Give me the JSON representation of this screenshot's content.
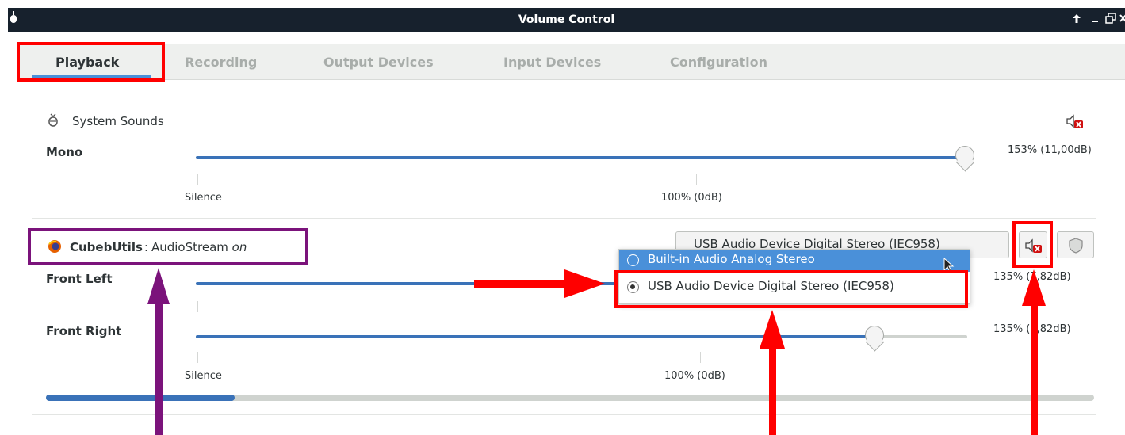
{
  "window": {
    "title": "Volume Control"
  },
  "tabs": [
    "Playback",
    "Recording",
    "Output Devices",
    "Input Devices",
    "Configuration"
  ],
  "system_sounds": {
    "name": "System Sounds",
    "channel": "Mono",
    "level_label": "153% (11,00dB)",
    "level_percent": 153,
    "scale_low": "Silence",
    "scale_mid": "100% (0dB)"
  },
  "stream": {
    "app": "CubebUtils",
    "separator": ":",
    "name": "AudioStream",
    "state": "on",
    "device": "USB Audio Device Digital Stereo (IEC958)",
    "channels": [
      {
        "name": "Front Left",
        "level_label": "135% (7,82dB)",
        "level_percent": 135
      },
      {
        "name": "Front Right",
        "level_label": "135% (7,82dB)",
        "level_percent": 135
      }
    ],
    "scale_low": "Silence",
    "scale_mid": "100% (0dB)",
    "peak_fraction": 0.18
  },
  "device_menu": {
    "options": [
      "Built-in Audio Analog Stereo",
      "USB Audio Device Digital Stereo (IEC958)"
    ],
    "highlighted": "Built-in Audio Analog Stereo",
    "selected": "USB Audio Device Digital Stereo (IEC958)"
  },
  "colors": {
    "annotation_red": "#ff0000",
    "annotation_purple": "#7b137b",
    "accent": "#4a90d9"
  }
}
